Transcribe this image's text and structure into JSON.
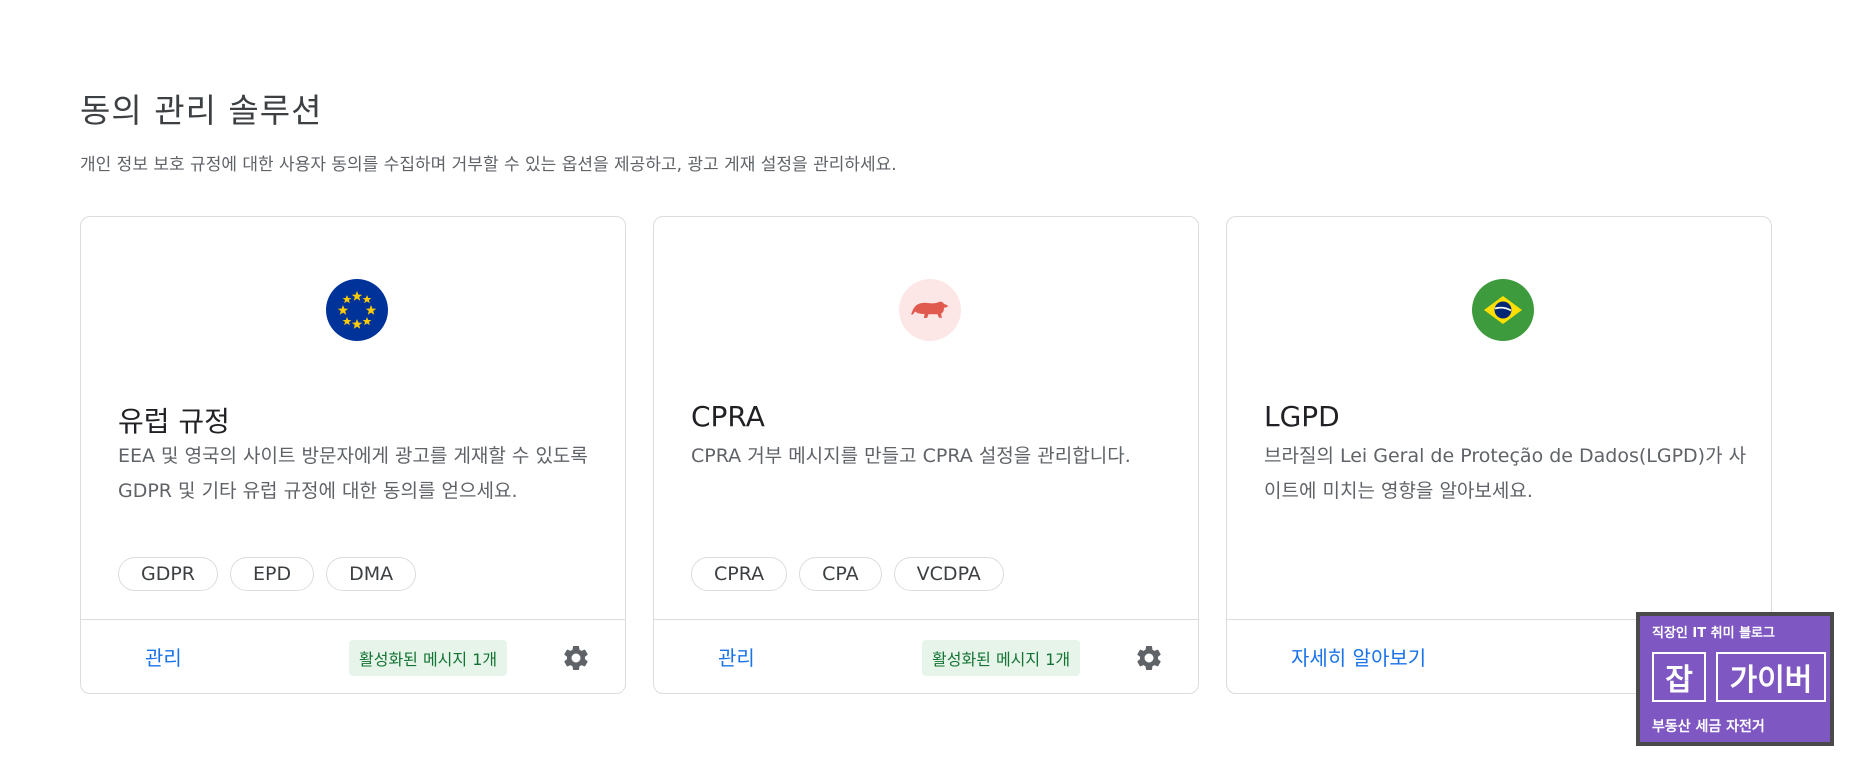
{
  "header": {
    "title": "동의 관리 솔루션",
    "description": "개인 정보 보호 규정에 대한 사용자 동의를 수집하며 거부할 수 있는 옵션을 제공하고, 광고 게재 설정을 관리하세요."
  },
  "cards": [
    {
      "icon": "eu-flag-icon",
      "icon_bg": "#003399",
      "title": "유럽 규정",
      "description": "EEA 및 영국의 사이트 방문자에게 광고를 게재할 수 있도록 GDPR 및 기타 유럽 규정에 대한 동의를 얻으세요.",
      "chips": [
        "GDPR",
        "EPD",
        "DMA"
      ],
      "link": "관리",
      "status": "활성화된 메시지 1개"
    },
    {
      "icon": "california-bear-icon",
      "icon_bg": "#fde7e6",
      "title": "CPRA",
      "description": "CPRA 거부 메시지를 만들고 CPRA 설정을 관리합니다.",
      "chips": [
        "CPRA",
        "CPA",
        "VCDPA"
      ],
      "link": "관리",
      "status": "활성화된 메시지 1개"
    },
    {
      "icon": "brazil-flag-icon",
      "icon_bg": "#3d9b3d",
      "title": "LGPD",
      "description": "브라질의 Lei Geral de Proteção de Dados(LGPD)가 사이트에 미치는 영향을 알아보세요.",
      "link": "자세히 알아보기"
    }
  ],
  "watermark": {
    "top": "직장인 IT 취미 블로그",
    "box1": "잡",
    "box2": "가이버",
    "bottom": "부동산 세금 자전거"
  },
  "colors": {
    "link": "#1a73e8",
    "status_bg": "#e6f4ea",
    "status_text": "#137333",
    "brand": "#7e57c2"
  }
}
